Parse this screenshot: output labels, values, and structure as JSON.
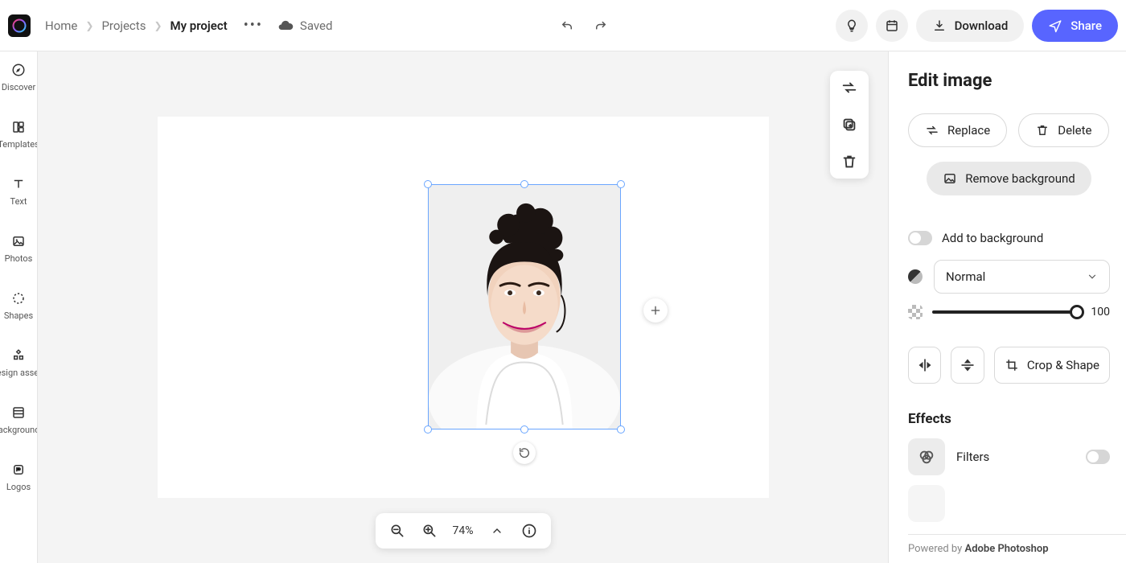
{
  "breadcrumbs": {
    "home": "Home",
    "projects": "Projects",
    "current": "My project"
  },
  "header": {
    "saved": "Saved",
    "download": "Download",
    "share": "Share"
  },
  "leftRail": {
    "discover": "Discover",
    "templates": "Templates",
    "text": "Text",
    "photos": "Photos",
    "shapes": "Shapes",
    "designAssets": "Design assets",
    "backgrounds": "Backgrounds",
    "logos": "Logos"
  },
  "canvas": {
    "zoom": "74%"
  },
  "inspector": {
    "title": "Edit image",
    "replace": "Replace",
    "delete": "Delete",
    "removeBg": "Remove background",
    "addToBg": "Add to background",
    "blendMode": "Normal",
    "opacity": "100",
    "cropShape": "Crop & Shape",
    "effects": "Effects",
    "filters": "Filters",
    "poweredBy": "Powered by ",
    "poweredByBrand": "Adobe Photoshop"
  }
}
